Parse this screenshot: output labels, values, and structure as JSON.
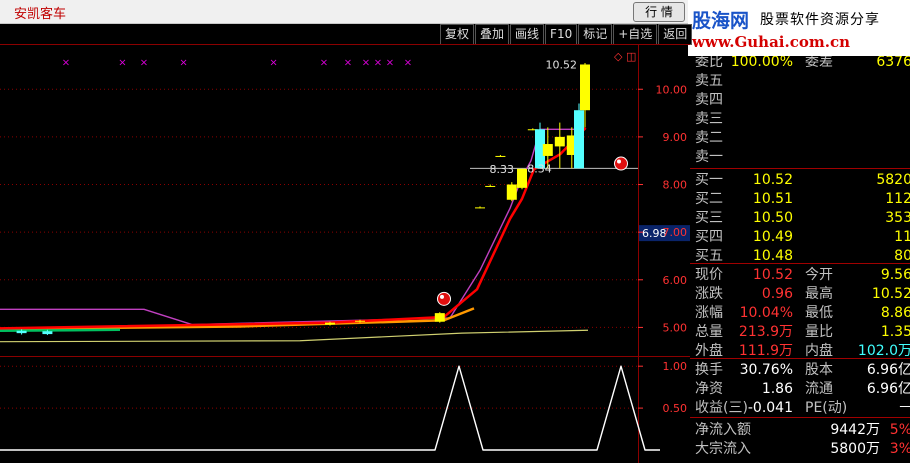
{
  "app": {
    "title": "安凯客车",
    "quote_button": "行 情"
  },
  "brand": {
    "name": "股海网",
    "slogan": "股票软件资源分享",
    "url": "www.Guhai.com.cn"
  },
  "toolbar": {
    "buttons": [
      "复权",
      "叠加",
      "画线",
      "F10",
      "标记",
      "+自选",
      "返回"
    ],
    "corner_icons": "◇ ◫"
  },
  "colors": {
    "up": "#ff3232",
    "down": "#54ffff",
    "text": "#c0c0c0",
    "grid": "#8b0000",
    "yellow": "#ffff00",
    "red_line": "#ff0000"
  },
  "chart_data": [
    {
      "type": "candlestick",
      "ylim": [
        4.4,
        10.95
      ],
      "y_ticks": [
        "10.00",
        "9.00",
        "8.00",
        "7.00",
        "6.00",
        "5.00"
      ],
      "y_tick_values": [
        10,
        9,
        8,
        7,
        6,
        5
      ],
      "current_price_label": "6.98",
      "current_price_value": 6.98,
      "horizontal_line_value": 8.34,
      "annotations": [
        {
          "label": "10.52",
          "x": 97.5,
          "y": 10.52
        },
        {
          "label": "8.33",
          "x": 87.0,
          "y": 8.33
        },
        {
          "label": "8.34",
          "x": 93.3,
          "y": 8.34
        }
      ],
      "candles": [
        {
          "x": 3.6,
          "open": 4.93,
          "close": 4.88,
          "high": 4.96,
          "low": 4.85
        },
        {
          "x": 7.9,
          "open": 4.92,
          "close": 4.86,
          "high": 4.95,
          "low": 4.84
        },
        {
          "x": 55.0,
          "open": 5.06,
          "close": 5.1,
          "high": 5.12,
          "low": 5.04
        },
        {
          "x": 60.0,
          "open": 5.12,
          "close": 5.14,
          "high": 5.16,
          "low": 5.1
        },
        {
          "x": 73.3,
          "open": 5.12,
          "close": 5.3,
          "high": 5.32,
          "low": 5.1
        },
        {
          "x": 80.0,
          "open": 7.52,
          "close": 7.52,
          "high": 7.54,
          "low": 7.5
        },
        {
          "x": 81.7,
          "open": 7.97,
          "close": 7.97,
          "high": 8.0,
          "low": 7.95
        },
        {
          "x": 83.4,
          "open": 8.6,
          "close": 8.6,
          "high": 8.62,
          "low": 8.58
        },
        {
          "x": 85.3,
          "open": 7.68,
          "close": 8.0,
          "high": 8.05,
          "low": 7.65
        },
        {
          "x": 87.0,
          "open": 7.93,
          "close": 8.33,
          "high": 8.33,
          "low": 7.9
        },
        {
          "x": 88.8,
          "open": 9.16,
          "close": 9.16,
          "high": 9.18,
          "low": 9.14
        },
        {
          "x": 90.0,
          "open": 9.16,
          "close": 8.34,
          "high": 9.3,
          "low": 8.34
        },
        {
          "x": 91.3,
          "open": 8.6,
          "close": 8.85,
          "high": 9.2,
          "low": 8.34
        },
        {
          "x": 93.3,
          "open": 8.8,
          "close": 9.0,
          "high": 9.3,
          "low": 8.34
        },
        {
          "x": 95.3,
          "open": 8.62,
          "close": 9.03,
          "high": 9.2,
          "low": 8.34
        },
        {
          "x": 96.5,
          "open": 9.56,
          "close": 8.34,
          "high": 9.7,
          "low": 8.34
        },
        {
          "x": 97.5,
          "open": 9.56,
          "close": 10.52,
          "high": 10.55,
          "low": 9.2
        }
      ],
      "ma_red": [
        [
          0,
          4.98
        ],
        [
          55,
          5.1
        ],
        [
          74,
          5.22
        ],
        [
          79.5,
          5.8
        ],
        [
          85,
          7.28
        ],
        [
          87,
          7.7
        ],
        [
          89,
          8.32
        ],
        [
          93.4,
          8.64
        ],
        [
          97.6,
          9.19
        ]
      ],
      "ma_magenta": [
        [
          0,
          5.38
        ],
        [
          24,
          5.38
        ],
        [
          32,
          5.06
        ],
        [
          75,
          5.2
        ],
        [
          80,
          6.2
        ],
        [
          85,
          7.5
        ],
        [
          87,
          8.15
        ],
        [
          88.5,
          8.5
        ],
        [
          90,
          9.16
        ],
        [
          97.6,
          9.16
        ]
      ],
      "ma_yellow": [
        [
          0,
          4.7
        ],
        [
          50,
          4.72
        ],
        [
          77,
          4.88
        ],
        [
          98,
          4.94
        ]
      ],
      "ma_orange": [
        [
          0,
          4.97
        ],
        [
          40,
          5.02
        ],
        [
          74,
          5.15
        ],
        [
          79,
          5.4
        ]
      ],
      "ma_green": [
        [
          0,
          4.93
        ],
        [
          12,
          4.94
        ],
        [
          20,
          4.95
        ]
      ],
      "markers_x": [
        11,
        20.4,
        24,
        30.6,
        45.6,
        54,
        58,
        61,
        63,
        65,
        68
      ],
      "marker_y_value": 10.5,
      "signals": [
        {
          "x": 74,
          "y": 5.6
        },
        {
          "x": 103.5,
          "y": 8.44
        }
      ]
    },
    {
      "type": "line",
      "ylim": [
        0,
        1.05
      ],
      "y_ticks": [
        "1.00",
        "0.50"
      ],
      "y_tick_values": [
        1,
        0.5
      ],
      "series_points": [
        [
          0,
          0
        ],
        [
          72.5,
          0
        ],
        [
          76.5,
          1
        ],
        [
          80.5,
          0
        ],
        [
          99.5,
          0
        ],
        [
          103.5,
          1
        ],
        [
          107.5,
          0
        ],
        [
          110,
          0
        ]
      ]
    }
  ],
  "panel": {
    "rows": [
      {
        "l1": "委比",
        "v1": "100.00%",
        "l2": "委差",
        "v2": "6376"
      },
      {
        "l1": "卖五",
        "v1": "",
        "l2": "",
        "v2": ""
      },
      {
        "l1": "卖四",
        "v1": "",
        "l2": "",
        "v2": ""
      },
      {
        "l1": "卖三",
        "v1": "",
        "l2": "",
        "v2": ""
      },
      {
        "l1": "卖二",
        "v1": "",
        "l2": "",
        "v2": ""
      },
      {
        "l1": "卖一",
        "v1": "",
        "l2": "",
        "v2": ""
      },
      {
        "l1": "买一",
        "v1": "10.52",
        "l2": "",
        "v2": "5820"
      },
      {
        "l1": "买二",
        "v1": "10.51",
        "l2": "",
        "v2": "112"
      },
      {
        "l1": "买三",
        "v1": "10.50",
        "l2": "",
        "v2": "353"
      },
      {
        "l1": "买四",
        "v1": "10.49",
        "l2": "",
        "v2": "11"
      },
      {
        "l1": "买五",
        "v1": "10.48",
        "l2": "",
        "v2": "80"
      },
      {
        "l1": "现价",
        "v1": "10.52",
        "l2": "今开",
        "v2": "9.56"
      },
      {
        "l1": "涨跌",
        "v1": "0.96",
        "l2": "最高",
        "v2": "10.52"
      },
      {
        "l1": "涨幅",
        "v1": "10.04%",
        "l2": "最低",
        "v2": "8.86"
      },
      {
        "l1": "总量",
        "v1": "213.9万",
        "l2": "量比",
        "v2": "1.35"
      },
      {
        "l1": "外盘",
        "v1": "111.9万",
        "l2": "内盘",
        "v2": "102.0万"
      },
      {
        "l1": "换手",
        "v1": "30.76%",
        "l2": "股本",
        "v2": "6.96亿"
      },
      {
        "l1": "净资",
        "v1": "1.86",
        "l2": "流通",
        "v2": "6.96亿"
      },
      {
        "l1": "收益(三)",
        "v1": "-0.041",
        "l2": "PE(动)",
        "v2": "－"
      },
      {
        "l1": "净流入额",
        "v1": "9442万",
        "l2": "",
        "v2": "5%"
      },
      {
        "l1": "大宗流入",
        "v1": "5800万",
        "l2": "",
        "v2": "3%"
      }
    ]
  }
}
